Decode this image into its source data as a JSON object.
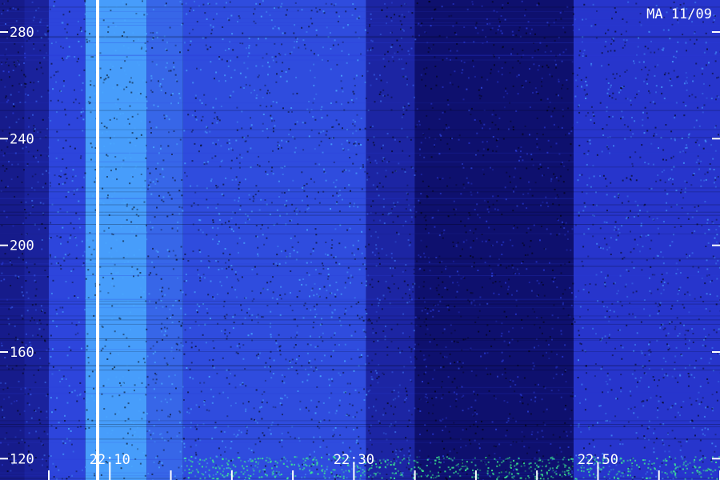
{
  "chart_data": {
    "type": "heatmap",
    "label": "MA 11/09",
    "y_ticks": [
      280,
      240,
      200,
      160,
      120
    ],
    "y_range": [
      112,
      292
    ],
    "x_ticks": [
      "22:10",
      "22:30",
      "22:50"
    ],
    "x_range_minutes": [
      "22:01",
      "23:00"
    ],
    "marker_time": "22:09",
    "colors": {
      "background": "#000000",
      "low": "#0a0a60",
      "mid": "#2a3ad8",
      "high": "#4aa8ff",
      "peak": "#3cf090",
      "marker": "#ffffff",
      "tick": "#ffffff"
    },
    "intensity_profile": [
      {
        "from": "22:01",
        "to": "22:03",
        "level": 0.18
      },
      {
        "from": "22:03",
        "to": "22:05",
        "level": 0.25
      },
      {
        "from": "22:05",
        "to": "22:08",
        "level": 0.55
      },
      {
        "from": "22:08",
        "to": "22:13",
        "level": 0.95
      },
      {
        "from": "22:13",
        "to": "22:16",
        "level": 0.7
      },
      {
        "from": "22:16",
        "to": "22:31",
        "level": 0.58
      },
      {
        "from": "22:31",
        "to": "22:35",
        "level": 0.28
      },
      {
        "from": "22:35",
        "to": "22:48",
        "level": 0.06
      },
      {
        "from": "22:48",
        "to": "23:00",
        "level": 0.45
      }
    ]
  }
}
